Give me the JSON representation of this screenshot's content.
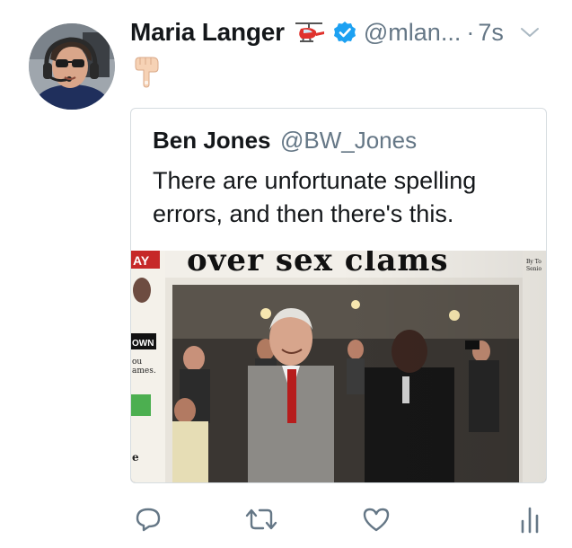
{
  "tweet": {
    "author": {
      "display_name": "Maria Langer",
      "handle": "@mlan...",
      "verified": true,
      "name_emoji": "helicopter-icon"
    },
    "separator": "·",
    "timestamp": "7s",
    "body_emoji": "pointing-down-hand-icon",
    "quoted_tweet": {
      "display_name": "Ben Jones",
      "handle": "@BW_Jones",
      "text": "There are unfortunate spelling errors, and then there's this.",
      "media": {
        "headline_fragment": "over sex clams",
        "left_column_fragments": [
          "AY",
          "OWN",
          "ou",
          "ames.",
          "e"
        ],
        "right_column_fragments": [
          "By To",
          "Senio"
        ]
      }
    },
    "actions": [
      "reply-icon",
      "retweet-icon",
      "like-icon",
      "analytics-icon"
    ]
  },
  "colors": {
    "text_primary": "#14171a",
    "text_secondary": "#657786",
    "verified_blue": "#1da1f2",
    "card_border": "#d6dce0",
    "icon_gray": "#657786"
  }
}
